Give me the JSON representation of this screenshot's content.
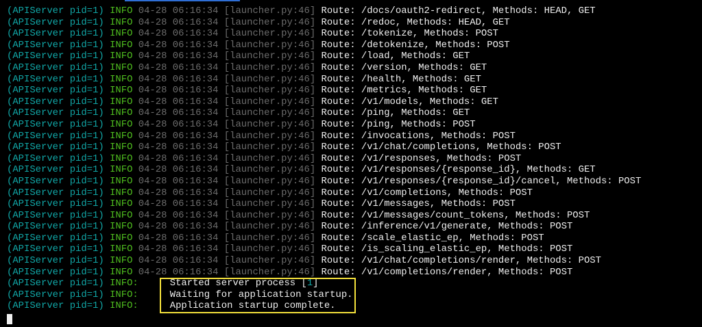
{
  "terminal": {
    "accent_tab_color": "#2f6fd6",
    "highlight_color": "#f5e23c",
    "route_lines": [
      {
        "proc": "(APIServer pid=1)",
        "level": "INFO",
        "time": "04-28 06:16:34",
        "source": "[launcher.py:46]",
        "message": "Route: /docs/oauth2-redirect, Methods: HEAD, GET"
      },
      {
        "proc": "(APIServer pid=1)",
        "level": "INFO",
        "time": "04-28 06:16:34",
        "source": "[launcher.py:46]",
        "message": "Route: /redoc, Methods: HEAD, GET"
      },
      {
        "proc": "(APIServer pid=1)",
        "level": "INFO",
        "time": "04-28 06:16:34",
        "source": "[launcher.py:46]",
        "message": "Route: /tokenize, Methods: POST"
      },
      {
        "proc": "(APIServer pid=1)",
        "level": "INFO",
        "time": "04-28 06:16:34",
        "source": "[launcher.py:46]",
        "message": "Route: /detokenize, Methods: POST"
      },
      {
        "proc": "(APIServer pid=1)",
        "level": "INFO",
        "time": "04-28 06:16:34",
        "source": "[launcher.py:46]",
        "message": "Route: /load, Methods: GET"
      },
      {
        "proc": "(APIServer pid=1)",
        "level": "INFO",
        "time": "04-28 06:16:34",
        "source": "[launcher.py:46]",
        "message": "Route: /version, Methods: GET"
      },
      {
        "proc": "(APIServer pid=1)",
        "level": "INFO",
        "time": "04-28 06:16:34",
        "source": "[launcher.py:46]",
        "message": "Route: /health, Methods: GET"
      },
      {
        "proc": "(APIServer pid=1)",
        "level": "INFO",
        "time": "04-28 06:16:34",
        "source": "[launcher.py:46]",
        "message": "Route: /metrics, Methods: GET"
      },
      {
        "proc": "(APIServer pid=1)",
        "level": "INFO",
        "time": "04-28 06:16:34",
        "source": "[launcher.py:46]",
        "message": "Route: /v1/models, Methods: GET"
      },
      {
        "proc": "(APIServer pid=1)",
        "level": "INFO",
        "time": "04-28 06:16:34",
        "source": "[launcher.py:46]",
        "message": "Route: /ping, Methods: GET"
      },
      {
        "proc": "(APIServer pid=1)",
        "level": "INFO",
        "time": "04-28 06:16:34",
        "source": "[launcher.py:46]",
        "message": "Route: /ping, Methods: POST"
      },
      {
        "proc": "(APIServer pid=1)",
        "level": "INFO",
        "time": "04-28 06:16:34",
        "source": "[launcher.py:46]",
        "message": "Route: /invocations, Methods: POST"
      },
      {
        "proc": "(APIServer pid=1)",
        "level": "INFO",
        "time": "04-28 06:16:34",
        "source": "[launcher.py:46]",
        "message": "Route: /v1/chat/completions, Methods: POST"
      },
      {
        "proc": "(APIServer pid=1)",
        "level": "INFO",
        "time": "04-28 06:16:34",
        "source": "[launcher.py:46]",
        "message": "Route: /v1/responses, Methods: POST"
      },
      {
        "proc": "(APIServer pid=1)",
        "level": "INFO",
        "time": "04-28 06:16:34",
        "source": "[launcher.py:46]",
        "message": "Route: /v1/responses/{response_id}, Methods: GET"
      },
      {
        "proc": "(APIServer pid=1)",
        "level": "INFO",
        "time": "04-28 06:16:34",
        "source": "[launcher.py:46]",
        "message": "Route: /v1/responses/{response_id}/cancel, Methods: POST"
      },
      {
        "proc": "(APIServer pid=1)",
        "level": "INFO",
        "time": "04-28 06:16:34",
        "source": "[launcher.py:46]",
        "message": "Route: /v1/completions, Methods: POST"
      },
      {
        "proc": "(APIServer pid=1)",
        "level": "INFO",
        "time": "04-28 06:16:34",
        "source": "[launcher.py:46]",
        "message": "Route: /v1/messages, Methods: POST"
      },
      {
        "proc": "(APIServer pid=1)",
        "level": "INFO",
        "time": "04-28 06:16:34",
        "source": "[launcher.py:46]",
        "message": "Route: /v1/messages/count_tokens, Methods: POST"
      },
      {
        "proc": "(APIServer pid=1)",
        "level": "INFO",
        "time": "04-28 06:16:34",
        "source": "[launcher.py:46]",
        "message": "Route: /inference/v1/generate, Methods: POST"
      },
      {
        "proc": "(APIServer pid=1)",
        "level": "INFO",
        "time": "04-28 06:16:34",
        "source": "[launcher.py:46]",
        "message": "Route: /scale_elastic_ep, Methods: POST"
      },
      {
        "proc": "(APIServer pid=1)",
        "level": "INFO",
        "time": "04-28 06:16:34",
        "source": "[launcher.py:46]",
        "message": "Route: /is_scaling_elastic_ep, Methods: POST"
      },
      {
        "proc": "(APIServer pid=1)",
        "level": "INFO",
        "time": "04-28 06:16:34",
        "source": "[launcher.py:46]",
        "message": "Route: /v1/chat/completions/render, Methods: POST"
      },
      {
        "proc": "(APIServer pid=1)",
        "level": "INFO",
        "time": "04-28 06:16:34",
        "source": "[launcher.py:46]",
        "message": "Route: /v1/completions/render, Methods: POST"
      }
    ],
    "startup_lines": [
      {
        "proc": "(APIServer pid=1)",
        "level": "INFO:",
        "message": "Started server process [",
        "pid": "1",
        "message_end": "]"
      },
      {
        "proc": "(APIServer pid=1)",
        "level": "INFO:",
        "message": "Waiting for application startup.",
        "pid": "",
        "message_end": ""
      },
      {
        "proc": "(APIServer pid=1)",
        "level": "INFO:",
        "message": "Application startup complete.",
        "pid": "",
        "message_end": ""
      }
    ]
  }
}
